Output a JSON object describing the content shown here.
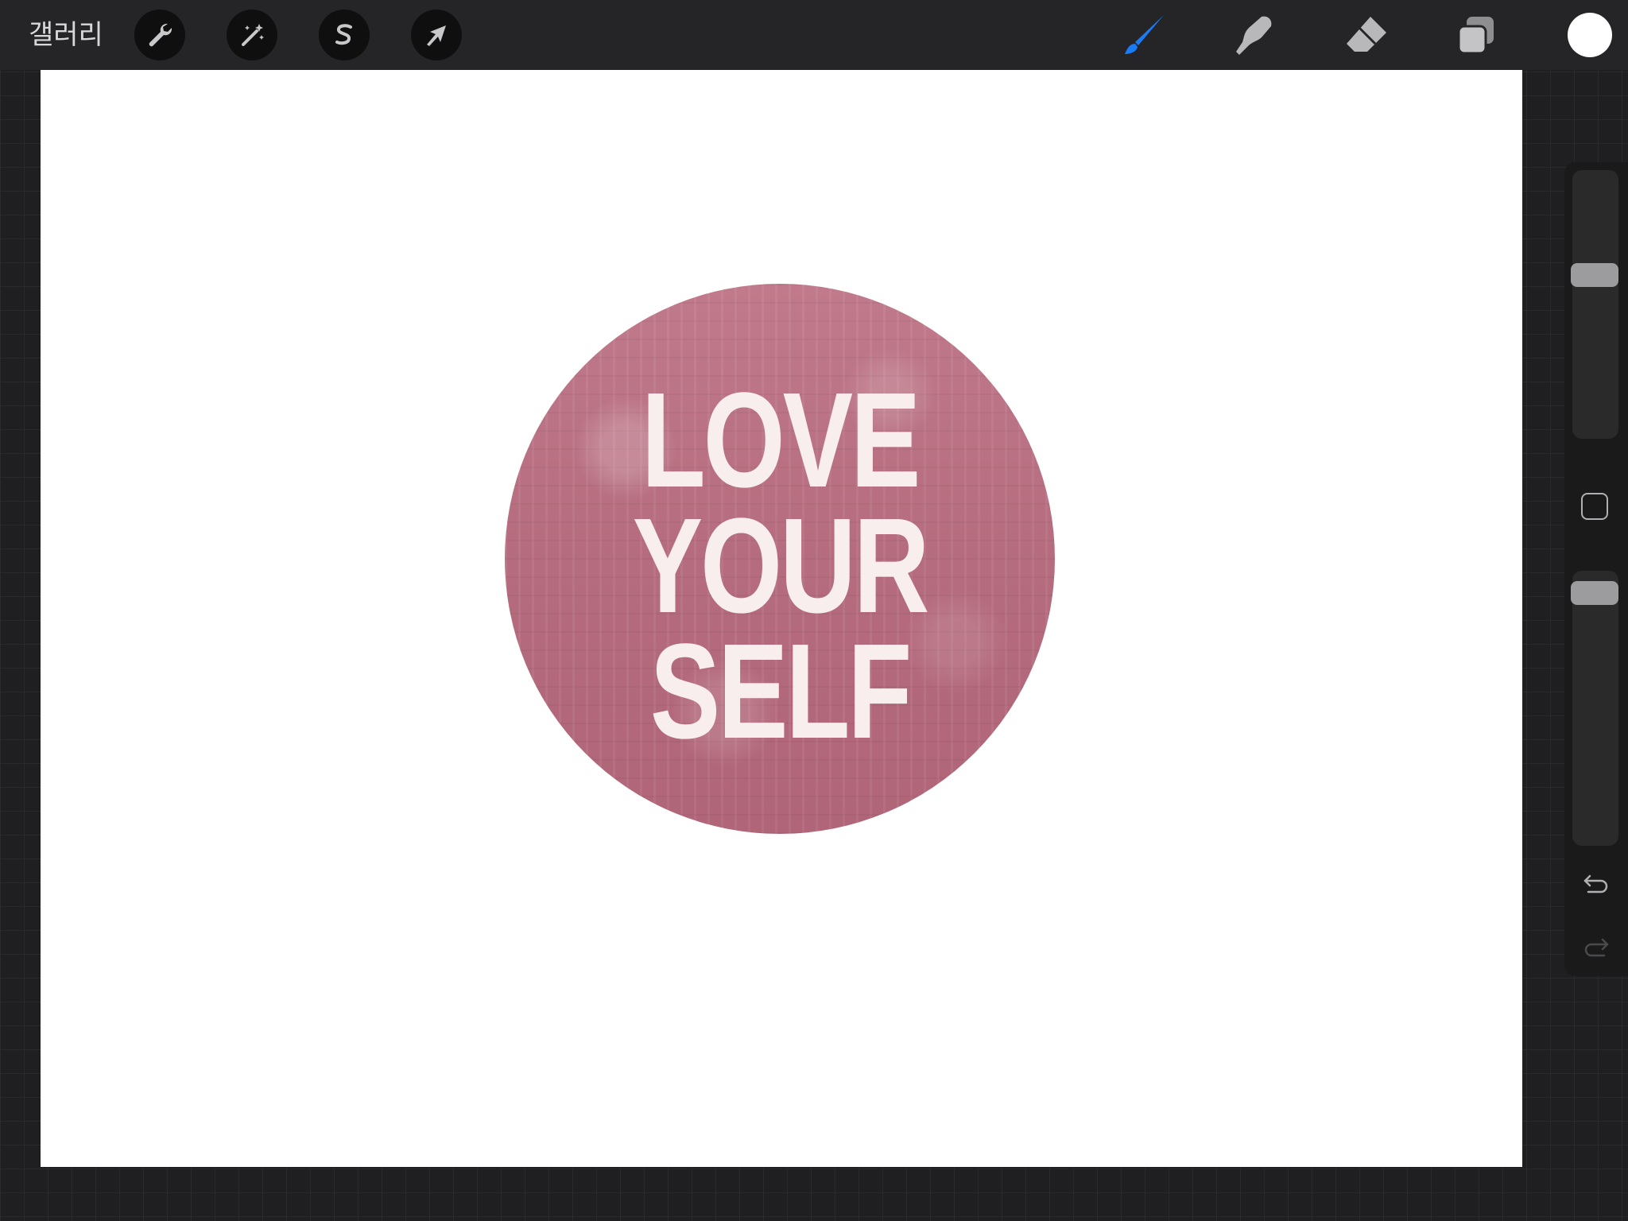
{
  "topbar": {
    "gallery_label": "갤러리",
    "left_tools": [
      {
        "name": "actions",
        "icon": "wrench-icon"
      },
      {
        "name": "adjustments",
        "icon": "magic-wand-icon"
      },
      {
        "name": "selection",
        "icon": "selection-s-icon"
      },
      {
        "name": "transform",
        "icon": "arrow-cursor-icon"
      }
    ],
    "right_tools": [
      {
        "name": "brush",
        "icon": "brush-icon",
        "active": true,
        "color": "#1a7cf5"
      },
      {
        "name": "smudge",
        "icon": "smudge-finger-icon",
        "active": false
      },
      {
        "name": "eraser",
        "icon": "eraser-icon",
        "active": false
      },
      {
        "name": "layers",
        "icon": "layers-icon",
        "active": false
      }
    ],
    "current_color": "#ffffff"
  },
  "canvas": {
    "background": "#ffffff",
    "artwork": {
      "lines": [
        "LOVE",
        "YOUR",
        "SELF"
      ],
      "circle_color": "#b56c7e",
      "text_color": "#f8eeee"
    }
  },
  "sidebar": {
    "brush_size_level": 0.62,
    "opacity_level": 0.96,
    "modify_icon": "square-icon",
    "undo_icon": "undo-icon",
    "redo_icon": "redo-icon",
    "redo_enabled": false
  }
}
